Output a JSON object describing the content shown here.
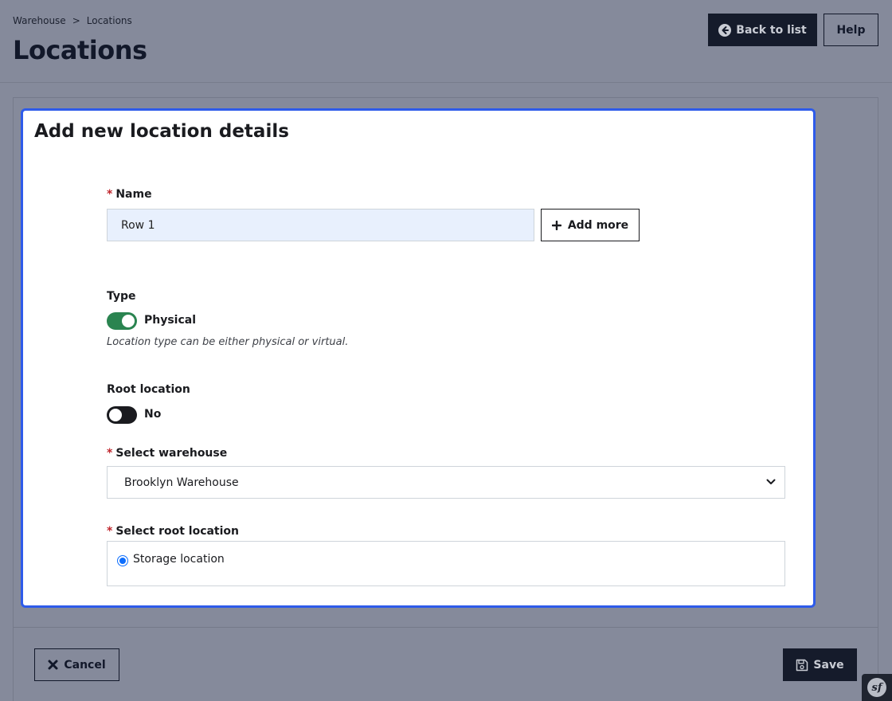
{
  "breadcrumb": {
    "items": [
      "Warehouse",
      "Locations"
    ],
    "separator": ">"
  },
  "header": {
    "title": "Locations",
    "back_label": "Back to list",
    "help_label": "Help"
  },
  "form": {
    "title": "Add new location details",
    "name": {
      "required": "*",
      "label": "Name",
      "value": "Row 1",
      "add_more_label": "Add more"
    },
    "type": {
      "label": "Type",
      "toggle_state": "on",
      "value_label": "Physical",
      "help": "Location type can be either physical or virtual."
    },
    "root": {
      "label": "Root location",
      "toggle_state": "off",
      "value_label": "No"
    },
    "warehouse": {
      "required": "*",
      "label": "Select warehouse",
      "selected": "Brooklyn Warehouse"
    },
    "root_location": {
      "required": "*",
      "label": "Select root location",
      "options": [
        {
          "label": "Storage location",
          "selected": true
        }
      ]
    }
  },
  "footer": {
    "cancel_label": "Cancel",
    "save_label": "Save"
  },
  "badge": {
    "text": "sf"
  },
  "colors": {
    "accent_border": "#2e5bea",
    "toggle_on": "#2a8450",
    "primary_button": "#151b2b",
    "required": "#c0262d"
  }
}
